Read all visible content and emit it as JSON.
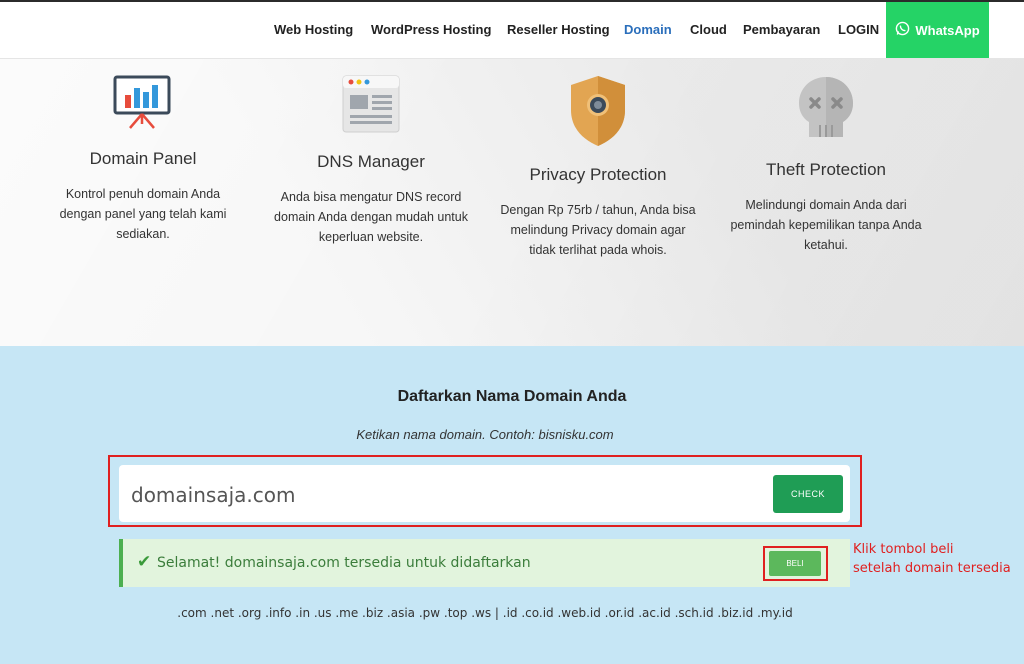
{
  "nav": {
    "items": [
      {
        "label": "Web Hosting",
        "active": false
      },
      {
        "label": "WordPress Hosting",
        "active": false
      },
      {
        "label": "Reseller Hosting",
        "active": false
      },
      {
        "label": "Domain",
        "active": true
      },
      {
        "label": "Cloud",
        "active": false
      },
      {
        "label": "Pembayaran",
        "active": false
      },
      {
        "label": "LOGIN",
        "active": false
      }
    ],
    "whatsapp": {
      "label": "WhatsApp",
      "icon": "whatsapp-icon",
      "color": "#25d366"
    }
  },
  "features": [
    {
      "icon": "presentation-chart-icon",
      "title": "Domain Panel",
      "desc": "Kontrol penuh domain Anda dengan panel yang telah kami sediakan."
    },
    {
      "icon": "dns-window-icon",
      "title": "DNS Manager",
      "desc": "Anda bisa mengatur DNS record domain Anda dengan mudah untuk keperluan website."
    },
    {
      "icon": "shield-icon",
      "title": "Privacy Protection",
      "desc": "Dengan Rp 75rb / tahun, Anda bisa melindung Privacy domain agar tidak terlihat pada whois."
    },
    {
      "icon": "skull-icon",
      "title": "Theft Protection",
      "desc": "Melindungi domain Anda dari pemindah kepemilikan tanpa Anda ketahui."
    }
  ],
  "domain_search": {
    "title": "Daftarkan Nama Domain Anda",
    "subtitle": "Ketikan nama domain. Contoh: bisnisku.com",
    "input_value": "domainsaja.com",
    "check_label": "CHECK",
    "result_text": "Selamat! domainsaja.com tersedia untuk didaftarkan",
    "buy_label": "BELI",
    "annotation": [
      "Klik tombol beli",
      "setelah domain tersedia"
    ],
    "tlds": ".com .net .org .info .in .us .me .biz .asia .pw .top .ws | .id .co.id .web.id .or.id .ac.id .sch.id .biz.id .my.id"
  },
  "colors": {
    "accent": "#2a6ebb",
    "section_bg": "#c6e6f5",
    "check_button": "#1f9d55",
    "success_bg": "#e2f4dd",
    "annotation_red": "#e02020"
  }
}
